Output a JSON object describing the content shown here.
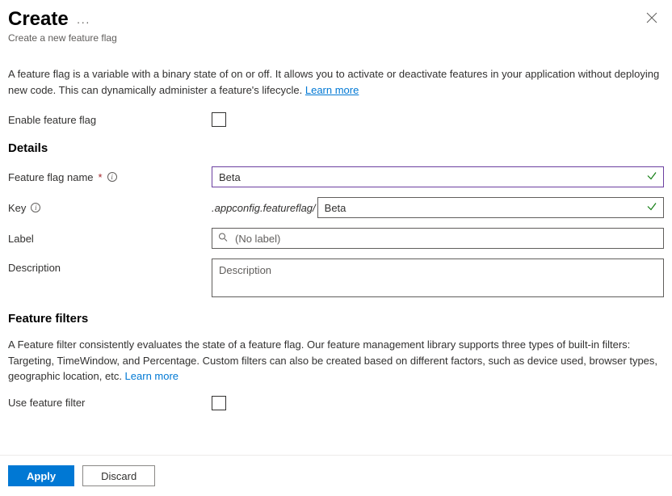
{
  "header": {
    "title": "Create",
    "subtitle": "Create a new feature flag"
  },
  "intro": {
    "text": "A feature flag is a variable with a binary state of on or off. It allows you to activate or deactivate features in your application without deploying new code. This can dynamically administer a feature's lifecycle. ",
    "learn_more": "Learn more"
  },
  "enable": {
    "label": "Enable feature flag",
    "checked": false
  },
  "details": {
    "heading": "Details",
    "name_label": "Feature flag name",
    "name_value": "Beta",
    "key_label": "Key",
    "key_prefix": ".appconfig.featureflag/",
    "key_value": "Beta",
    "label_label": "Label",
    "label_placeholder": "(No label)",
    "label_value": "",
    "description_label": "Description",
    "description_placeholder": "Description",
    "description_value": ""
  },
  "filters": {
    "heading": "Feature filters",
    "intro_text": "A Feature filter consistently evaluates the state of a feature flag. Our feature management library supports three types of built-in filters: Targeting, TimeWindow, and Percentage. Custom filters can also be created based on different factors, such as device used, browser types, geographic location, etc. ",
    "learn_more": "Learn more",
    "use_label": "Use feature filter",
    "use_checked": false
  },
  "footer": {
    "apply": "Apply",
    "discard": "Discard"
  }
}
